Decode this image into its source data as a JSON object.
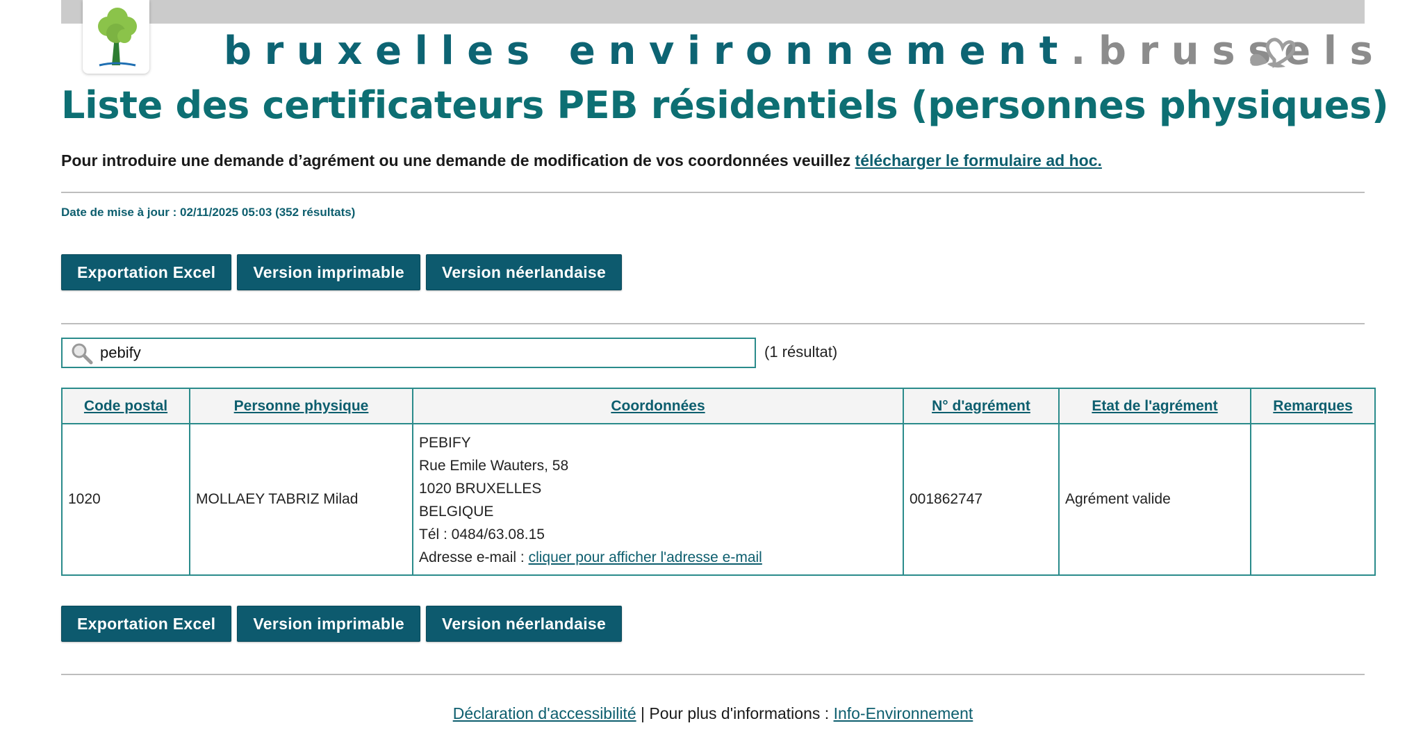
{
  "header": {
    "brand_primary": "bruxelles environnement",
    "brand_dot": ".",
    "brand_secondary": "brussels",
    "logo_icon": "tree-icon",
    "brand_icon": "heart-icon"
  },
  "page": {
    "title": "Liste des certificateurs PEB résidentiels (personnes physiques)",
    "intro_text": "Pour introduire une demande d’agrément ou une demande de modification de vos coordonnées veuillez ",
    "intro_link": "télécharger le formulaire ad hoc.",
    "updated": "Date de mise à jour : 02/11/2025 05:03 (352 résultats)"
  },
  "buttons": {
    "export": "Exportation Excel",
    "print": "Version imprimable",
    "dutch": "Version néerlandaise"
  },
  "search": {
    "value": "pebify",
    "count": "(1 résultat)",
    "icon": "search-icon"
  },
  "table": {
    "headers": {
      "postal": "Code postal",
      "person": "Personne physique",
      "contact": "Coordonnées",
      "number": "N° d'agrément",
      "status": "Etat de l'agrément",
      "remarks": "Remarques"
    },
    "rows": [
      {
        "postal": "1020",
        "person": "MOLLAEY TABRIZ Milad",
        "contact": {
          "company": "PEBIFY",
          "street": "Rue Emile Wauters, 58",
          "city": "1020 BRUXELLES",
          "country": "BELGIQUE",
          "phone": "Tél : 0484/63.08.15",
          "email_label": "Adresse e-mail : ",
          "email_link": "cliquer pour afficher l'adresse e-mail"
        },
        "number": "001862747",
        "status": "Agrément valide",
        "remarks": ""
      }
    ]
  },
  "footer": {
    "accessibility": "Déclaration d'accessibilité",
    "sep": " | Pour plus d'informations : ",
    "info": "Info-Environnement"
  },
  "colors": {
    "accent": "#0d6f73",
    "button": "#0d5a6e",
    "border": "#2a8b8b",
    "topbar": "#cbcbcb"
  }
}
